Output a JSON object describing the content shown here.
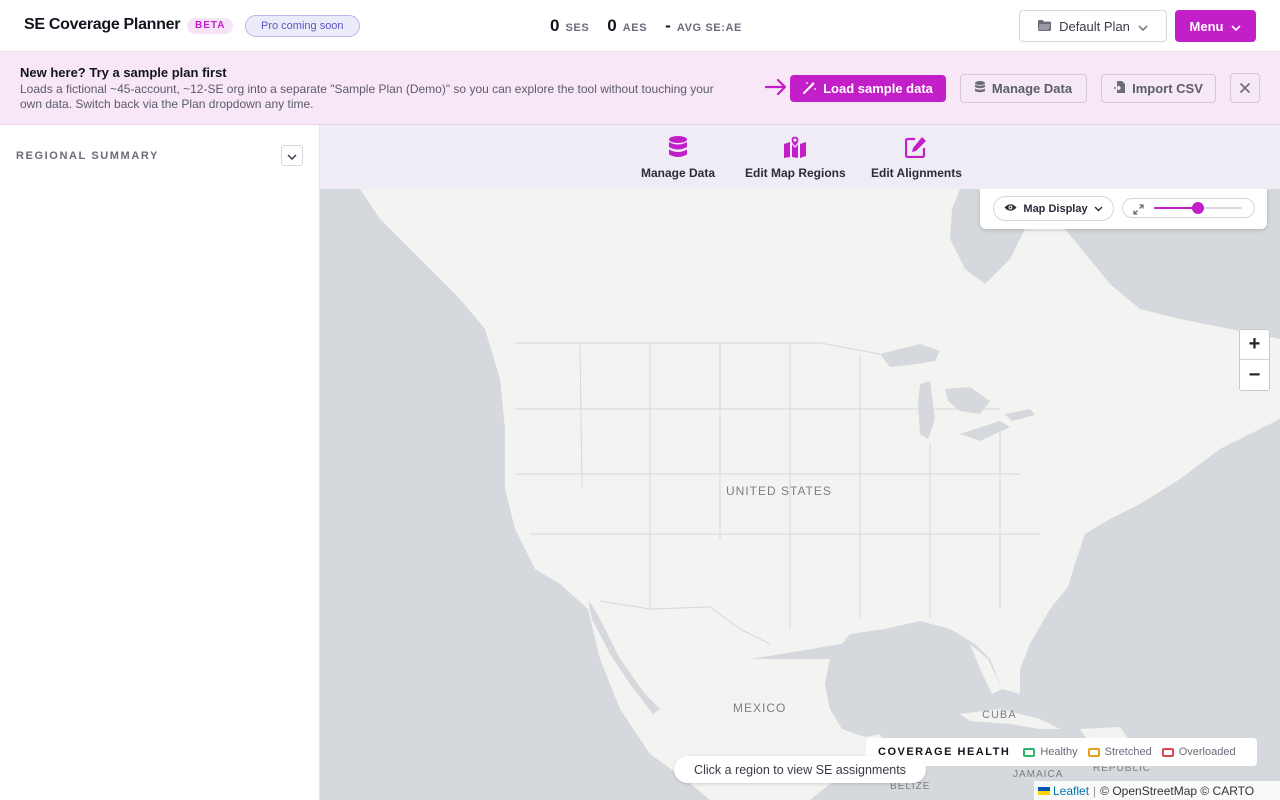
{
  "header": {
    "app_title": "SE Coverage Planner",
    "beta_badge": "BETA",
    "pro_pill": "Pro coming soon",
    "stats": [
      {
        "value": "0",
        "label": "SES"
      },
      {
        "value": "0",
        "label": "AES"
      },
      {
        "value": "-",
        "label": "AVG SE:AE"
      }
    ],
    "plan_selector": "Default Plan",
    "menu_label": "Menu"
  },
  "banner": {
    "title": "New here? Try a sample plan first",
    "text": "Loads a fictional ~45-account, ~12-SE org into a separate \"Sample Plan (Demo)\" so you can explore the tool without touching your own data. Switch back via the Plan dropdown any time.",
    "load_sample": "Load sample data",
    "manage_data": "Manage Data",
    "import_csv": "Import CSV"
  },
  "sidebar": {
    "title": "REGIONAL SUMMARY"
  },
  "toolbar": {
    "manage_data": "Manage Data",
    "edit_map_regions": "Edit Map Regions",
    "edit_alignments": "Edit Alignments"
  },
  "map": {
    "display_button": "Map Display",
    "opacity_value": 0.5,
    "zoom_in": "+",
    "zoom_out": "−",
    "labels": {
      "united_states": "UNITED STATES",
      "mexico": "MEXICO",
      "cuba": "CUBA",
      "jamaica": "JAMAICA",
      "republic": "REPUBLIC",
      "belize": "BELIZE"
    },
    "legend": {
      "title": "COVERAGE HEALTH",
      "items": [
        {
          "label": "Healthy",
          "color": "#2fb36b"
        },
        {
          "label": "Stretched",
          "color": "#e3a21a"
        },
        {
          "label": "Overloaded",
          "color": "#d9484e"
        }
      ]
    },
    "hint": "Click a region to view SE assignments",
    "attribution": {
      "leaflet": "Leaflet",
      "rest": "© OpenStreetMap © CARTO"
    }
  },
  "colors": {
    "accent": "#c21fc8",
    "banner_bg": "#f7e7f7",
    "toolbar_bg": "#efecf5",
    "water": "#d5d8dc",
    "land": "#f3f3f1"
  }
}
